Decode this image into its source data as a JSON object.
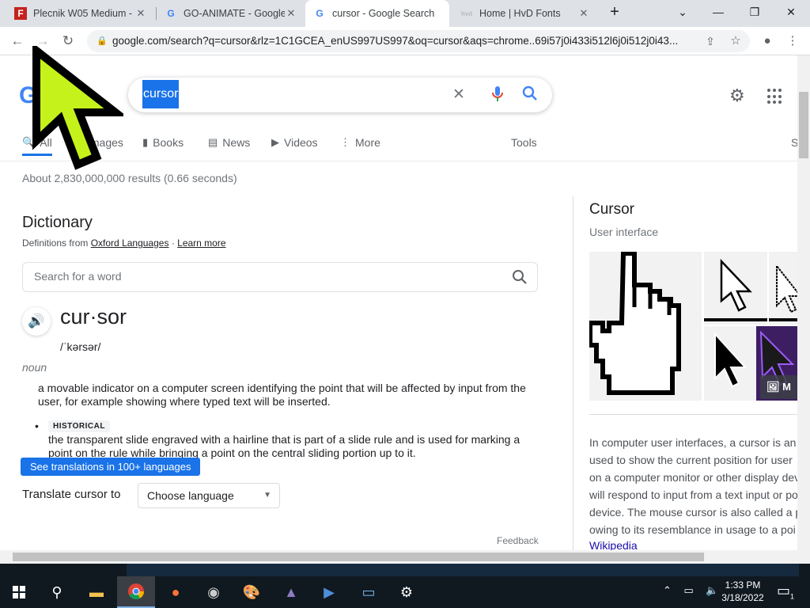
{
  "browser": {
    "tabs": [
      {
        "title": "Plecnik W05 Medium -",
        "favicon": "F"
      },
      {
        "title": "GO-ANIMATE - Google",
        "favicon": "G"
      },
      {
        "title": "cursor - Google Search",
        "favicon": "G",
        "active": true
      },
      {
        "title": "Home | HvD Fonts",
        "favicon": "hvd"
      }
    ],
    "url": "google.com/search?q=cursor&rlz=1C1GCEA_enUS997US997&oq=cursor&aqs=chrome..69i57j0i433i512l6j0i512j0i43..."
  },
  "search": {
    "logo": "Google",
    "query": "cursor",
    "nav": {
      "all": "All",
      "images": "Images",
      "books": "Books",
      "news": "News",
      "videos": "Videos",
      "more": "More",
      "tools": "Tools",
      "safe": "S"
    },
    "stats": "About 2,830,000,000 results (0.66 seconds)"
  },
  "dictionary": {
    "heading": "Dictionary",
    "source_prefix": "Definitions from",
    "source_link": "Oxford Languages",
    "source_sep": "·",
    "learn_more": "Learn more",
    "search_placeholder": "Search for a word",
    "word": "cur·sor",
    "phonetic": "/ˈkərsər/",
    "part_of_speech": "noun",
    "definition_1": "a movable indicator on a computer screen identifying the point that will be affected by input from the user, for example showing where typed text will be inserted.",
    "historical_label": "HISTORICAL",
    "definition_2": "the transparent slide engraved with a hairline that is part of a slide rule and is used for marking a point on the rule while bringing a point on the central sliding portion up to it.",
    "translations_button": "See translations in 100+ languages",
    "translate_label": "Translate cursor to",
    "translate_select": "Choose language",
    "feedback": "Feedback"
  },
  "knowledge_panel": {
    "title": "Cursor",
    "subtitle": "User interface",
    "more_badge": "M",
    "description_lines": [
      "In computer user interfaces, a cursor is an",
      "used to show the current position for user",
      "on a computer monitor or other display dev",
      "will respond to input from a text input or po",
      "device. The mouse cursor is also called a p",
      "owing to its resemblance in usage to a poi"
    ],
    "source_link": "Wikipedia"
  },
  "taskbar": {
    "time": "1:33 PM",
    "date": "3/18/2022",
    "notification_count": "1"
  },
  "colors": {
    "accent": "#1a73e8",
    "cursor_fill": "#c5f21a",
    "taskbar": "#101820"
  }
}
